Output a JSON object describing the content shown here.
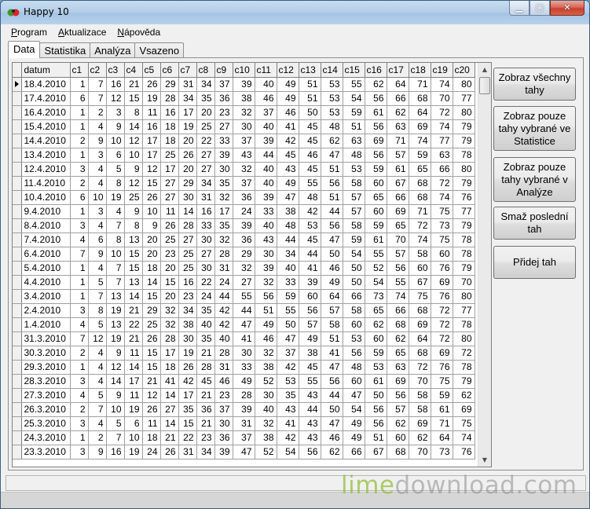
{
  "window": {
    "title": "Happy 10"
  },
  "menu": [
    {
      "label": "Program",
      "name": "menu-program"
    },
    {
      "label": "Aktualizace",
      "name": "menu-aktualizace"
    },
    {
      "label": "Nápověda",
      "name": "menu-napoveda"
    }
  ],
  "tabs": [
    {
      "label": "Data",
      "name": "tab-data",
      "active": true
    },
    {
      "label": "Statistika",
      "name": "tab-statistika"
    },
    {
      "label": "Analýza",
      "name": "tab-analyza"
    },
    {
      "label": "Vsazeno",
      "name": "tab-vsazeno"
    }
  ],
  "grid": {
    "columns": [
      "datum",
      "c1",
      "c2",
      "c3",
      "c4",
      "c5",
      "c6",
      "c7",
      "c8",
      "c9",
      "c10",
      "c11",
      "c12",
      "c13",
      "c14",
      "c15",
      "c16",
      "c17",
      "c18",
      "c19",
      "c20"
    ],
    "rows": [
      [
        "18.4.2010",
        1,
        7,
        16,
        21,
        26,
        29,
        31,
        34,
        37,
        39,
        40,
        49,
        51,
        53,
        55,
        62,
        64,
        71,
        74,
        80
      ],
      [
        "17.4.2010",
        6,
        7,
        12,
        15,
        19,
        28,
        34,
        35,
        36,
        38,
        46,
        49,
        51,
        53,
        54,
        56,
        66,
        68,
        70,
        77
      ],
      [
        "16.4.2010",
        1,
        2,
        3,
        8,
        11,
        16,
        17,
        20,
        23,
        32,
        37,
        46,
        50,
        53,
        59,
        61,
        62,
        64,
        72,
        80
      ],
      [
        "15.4.2010",
        1,
        4,
        9,
        14,
        16,
        18,
        19,
        25,
        27,
        30,
        40,
        41,
        45,
        48,
        51,
        56,
        63,
        69,
        74,
        79
      ],
      [
        "14.4.2010",
        2,
        9,
        10,
        12,
        17,
        18,
        20,
        22,
        33,
        37,
        39,
        42,
        45,
        62,
        63,
        69,
        71,
        74,
        77,
        79
      ],
      [
        "13.4.2010",
        1,
        3,
        6,
        10,
        17,
        25,
        26,
        27,
        39,
        43,
        44,
        45,
        46,
        47,
        48,
        56,
        57,
        59,
        63,
        78
      ],
      [
        "12.4.2010",
        3,
        4,
        5,
        9,
        12,
        17,
        20,
        27,
        30,
        32,
        40,
        43,
        45,
        51,
        53,
        59,
        61,
        65,
        66,
        80
      ],
      [
        "11.4.2010",
        2,
        4,
        8,
        12,
        15,
        27,
        29,
        34,
        35,
        37,
        40,
        49,
        55,
        56,
        58,
        60,
        67,
        68,
        72,
        79
      ],
      [
        "10.4.2010",
        6,
        10,
        19,
        25,
        26,
        27,
        30,
        31,
        32,
        36,
        39,
        47,
        48,
        51,
        57,
        65,
        66,
        68,
        74,
        76
      ],
      [
        "9.4.2010",
        1,
        3,
        4,
        9,
        10,
        11,
        14,
        16,
        17,
        24,
        33,
        38,
        42,
        44,
        57,
        60,
        69,
        71,
        75,
        77
      ],
      [
        "8.4.2010",
        3,
        4,
        7,
        8,
        9,
        26,
        28,
        33,
        35,
        39,
        40,
        48,
        53,
        56,
        58,
        59,
        65,
        72,
        73,
        79
      ],
      [
        "7.4.2010",
        4,
        6,
        8,
        13,
        20,
        25,
        27,
        30,
        32,
        36,
        43,
        44,
        45,
        47,
        59,
        61,
        70,
        74,
        75,
        78
      ],
      [
        "6.4.2010",
        7,
        9,
        10,
        15,
        20,
        23,
        25,
        27,
        28,
        29,
        30,
        34,
        44,
        50,
        54,
        55,
        57,
        58,
        60,
        78
      ],
      [
        "5.4.2010",
        1,
        4,
        7,
        15,
        18,
        20,
        25,
        30,
        31,
        32,
        39,
        40,
        41,
        46,
        50,
        52,
        56,
        60,
        76,
        79
      ],
      [
        "4.4.2010",
        1,
        5,
        7,
        13,
        14,
        15,
        16,
        22,
        24,
        27,
        32,
        33,
        39,
        49,
        50,
        54,
        55,
        67,
        69,
        70
      ],
      [
        "3.4.2010",
        1,
        7,
        13,
        14,
        15,
        20,
        23,
        24,
        44,
        55,
        56,
        59,
        60,
        64,
        66,
        73,
        74,
        75,
        76,
        80
      ],
      [
        "2.4.2010",
        3,
        8,
        19,
        21,
        29,
        32,
        34,
        35,
        42,
        44,
        51,
        55,
        56,
        57,
        58,
        65,
        66,
        68,
        72,
        77
      ],
      [
        "1.4.2010",
        4,
        5,
        13,
        22,
        25,
        32,
        38,
        40,
        42,
        47,
        49,
        50,
        57,
        58,
        60,
        62,
        68,
        69,
        72,
        78
      ],
      [
        "31.3.2010",
        7,
        12,
        19,
        21,
        26,
        28,
        30,
        35,
        40,
        41,
        46,
        47,
        49,
        51,
        53,
        60,
        62,
        64,
        72,
        80
      ],
      [
        "30.3.2010",
        2,
        4,
        9,
        11,
        15,
        17,
        19,
        21,
        28,
        30,
        32,
        37,
        38,
        41,
        56,
        59,
        65,
        68,
        69,
        72
      ],
      [
        "29.3.2010",
        1,
        4,
        12,
        14,
        15,
        18,
        26,
        28,
        31,
        33,
        38,
        42,
        45,
        47,
        48,
        53,
        63,
        72,
        76,
        78
      ],
      [
        "28.3.2010",
        3,
        4,
        14,
        17,
        21,
        41,
        42,
        45,
        46,
        49,
        52,
        53,
        55,
        56,
        60,
        61,
        69,
        70,
        75,
        79
      ],
      [
        "27.3.2010",
        4,
        5,
        9,
        11,
        12,
        14,
        17,
        21,
        23,
        28,
        30,
        35,
        43,
        44,
        47,
        50,
        56,
        58,
        59,
        62
      ],
      [
        "26.3.2010",
        2,
        7,
        10,
        19,
        26,
        27,
        35,
        36,
        37,
        39,
        40,
        43,
        44,
        50,
        54,
        56,
        57,
        58,
        61,
        69
      ],
      [
        "25.3.2010",
        3,
        4,
        5,
        6,
        11,
        14,
        15,
        21,
        30,
        31,
        32,
        41,
        43,
        47,
        49,
        56,
        62,
        69,
        71,
        75
      ],
      [
        "24.3.2010",
        1,
        2,
        7,
        10,
        18,
        21,
        22,
        23,
        36,
        37,
        38,
        42,
        43,
        46,
        49,
        51,
        60,
        62,
        64,
        74
      ],
      [
        "23.3.2010",
        3,
        9,
        16,
        19,
        24,
        26,
        31,
        34,
        39,
        47,
        52,
        54,
        56,
        62,
        66,
        67,
        68,
        70,
        73,
        76
      ]
    ]
  },
  "buttons": [
    {
      "label": "Zobraz všechny tahy",
      "name": "show-all-draws-button"
    },
    {
      "label": "Zobraz pouze tahy vybrané ve Statistice",
      "name": "show-statistics-draws-button"
    },
    {
      "label": "Zobraz pouze tahy vybrané v Analýze",
      "name": "show-analysis-draws-button"
    },
    {
      "label": "Smaž poslední tah",
      "name": "delete-last-draw-button"
    },
    {
      "label": "Přidej tah",
      "name": "add-draw-button"
    }
  ],
  "watermark": {
    "part1": "lime",
    "part2": "download.com"
  }
}
